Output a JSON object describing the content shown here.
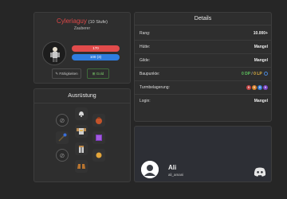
{
  "profile": {
    "name": "Cyleriaguy",
    "level": "(10 Stufe)",
    "class": "Zauberer",
    "hp": "170",
    "mp": "100 (3)",
    "skills_button": "Fähigkeiten",
    "gold_button": "Gold"
  },
  "equipment": {
    "title": "Ausrüstung"
  },
  "details": {
    "title": "Details",
    "rows": [
      {
        "label": "Rang:",
        "value": "10.000+"
      },
      {
        "label": "Hütte:",
        "value": "Mangel"
      },
      {
        "label": "Gilde:",
        "value": "Mangel"
      },
      {
        "label": "Baupunkte:",
        "value": ""
      },
      {
        "label": "Turmbelagerung:",
        "value": ""
      },
      {
        "label": "Login:",
        "value": "Mangel"
      }
    ],
    "baupunkte": {
      "dp": "0 DP",
      "sep": "/",
      "lp": "0 LP"
    },
    "tower_badges": [
      {
        "text": "0",
        "color": "#c64545"
      },
      {
        "text": "0",
        "color": "#d9842f"
      },
      {
        "text": "0",
        "color": "#3d7fd6"
      },
      {
        "text": "0",
        "color": "#7a45c5"
      }
    ]
  },
  "discord": {
    "name": "Ali",
    "handle": "ali_amani"
  },
  "colors": {
    "hp_bar": "#e14b4b",
    "mp_bar": "#2f7de0",
    "name_red": "#e04848",
    "dp_green": "#5ec35e",
    "lp_yellow": "#e3b441"
  }
}
